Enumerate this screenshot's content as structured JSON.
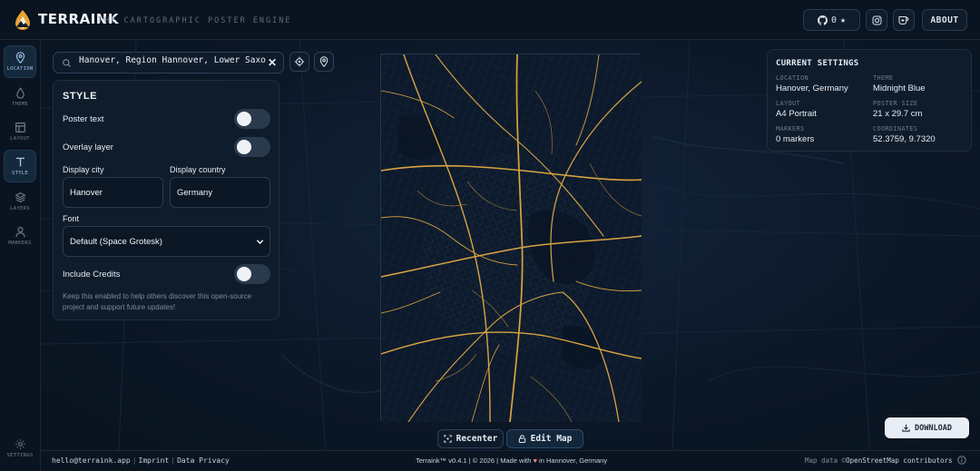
{
  "header": {
    "brand": "TERRAINK",
    "tagline": "THE CARTOGRAPHIC POSTER ENGINE",
    "github_stars": "0",
    "about_label": "ABOUT"
  },
  "rail": {
    "items": [
      {
        "label": "LOCATION",
        "icon": "pin-icon",
        "active": true
      },
      {
        "label": "THEME",
        "icon": "drop-icon",
        "active": false
      },
      {
        "label": "LAYOUT",
        "icon": "layout-icon",
        "active": false
      },
      {
        "label": "STYLE",
        "icon": "text-icon",
        "active": true
      },
      {
        "label": "LAYERS",
        "icon": "layers-icon",
        "active": false
      },
      {
        "label": "MARKERS",
        "icon": "person-icon",
        "active": false
      }
    ],
    "settings_label": "SETTINGS"
  },
  "search": {
    "value": "Hanover, Region Hannover, Lower Saxo",
    "clear": "✕"
  },
  "style_panel": {
    "title": "STYLE",
    "poster_text_label": "Poster text",
    "overlay_layer_label": "Overlay layer",
    "display_city_label": "Display city",
    "display_city_value": "Hanover",
    "display_country_label": "Display country",
    "display_country_value": "Germany",
    "font_label": "Font",
    "font_value": "Default (Space Grotesk)",
    "include_credits_label": "Include Credits",
    "hint": "Keep this enabled to help others discover this open-source project and support future updates!"
  },
  "current_settings": {
    "title": "CURRENT SETTINGS",
    "location_key": "LOCATION",
    "location": "Hanover, Germany",
    "theme_key": "THEME",
    "theme": "Midnight Blue",
    "layout_key": "LAYOUT",
    "layout": "A4 Portrait",
    "poster_size_key": "POSTER SIZE",
    "poster_size": "21 x 29.7 cm",
    "markers_key": "MARKERS",
    "markers": "0 markers",
    "coordinates_key": "COORDINATES",
    "coordinates": "52.3759, 9.7320"
  },
  "map_controls": {
    "recenter": "Recenter",
    "edit_map": "Edit Map",
    "download": "DOWNLOAD"
  },
  "footer": {
    "email": "hello@terraink.app",
    "imprint": "Imprint",
    "privacy": "Data Privacy",
    "center_pre": "Terraink™ v0.4.1 | © 2026 | Made with",
    "center_post": "in Hannover, Germany",
    "map_data": "Map data ©",
    "osm": "OpenStreetMap contributors"
  },
  "colors": {
    "accent_roads": "#d9a441",
    "background": "#0b1521",
    "poster_bg": "#0d1a2c"
  }
}
